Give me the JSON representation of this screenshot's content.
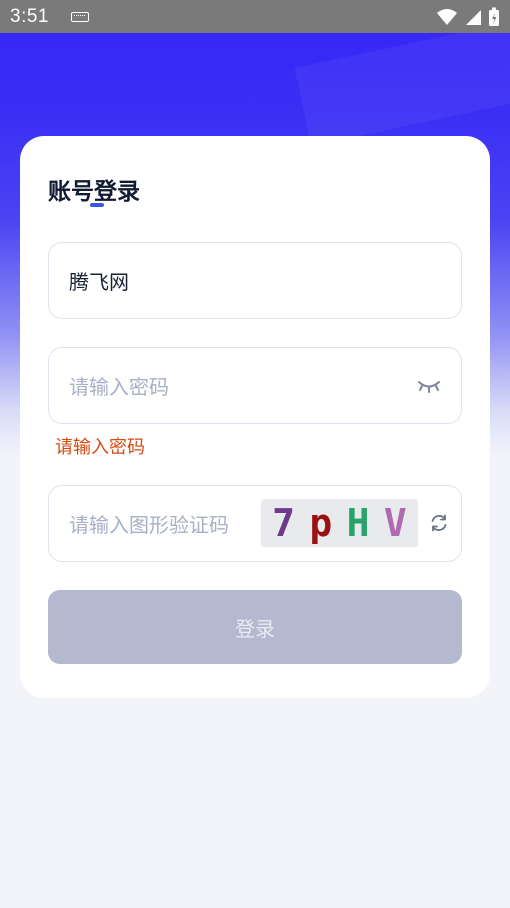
{
  "status_bar": {
    "time": "3:51"
  },
  "login": {
    "title": "账号登录",
    "username": {
      "value": "腾飞网"
    },
    "password": {
      "placeholder": "请输入密码",
      "error": "请输入密码"
    },
    "captcha": {
      "placeholder": "请输入图形验证码",
      "chars": [
        "7",
        "p",
        "H",
        "V"
      ],
      "char_colors": [
        "#6e3a8a",
        "#9a1111",
        "#2aa36a",
        "#b06ab0"
      ]
    },
    "submit_label": "登录"
  },
  "colors": {
    "accent": "#3a56e8",
    "error": "#d84a12",
    "button_disabled": "#b4b9cf"
  }
}
